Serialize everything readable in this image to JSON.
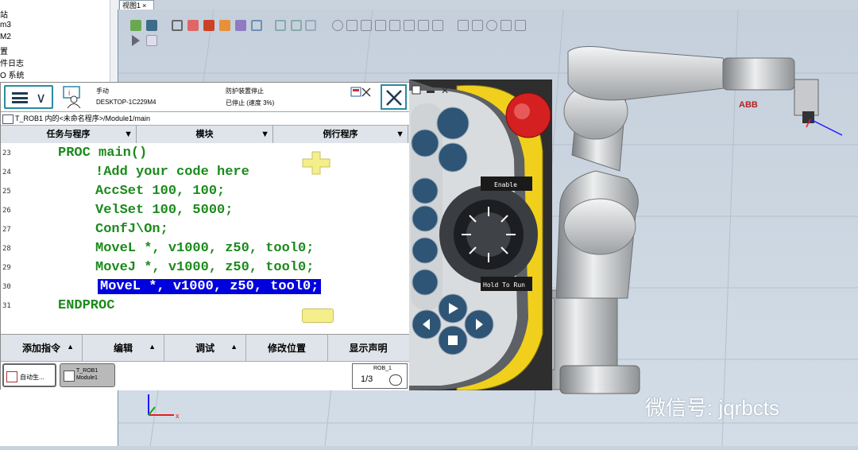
{
  "tree": {
    "items": [
      "站",
      "m3",
      "M2",
      "置",
      "件日志",
      "O 系统"
    ]
  },
  "view_tab": {
    "label": "视图1",
    "close": "×"
  },
  "flexpendant": {
    "status": {
      "mode": "手动",
      "controller": "DESKTOP-1C229M4",
      "state": "防护装置停止",
      "speed": "已停止 (速度 3%)"
    },
    "path": "T_ROB1 内的<未命名程序>/Module1/main",
    "columns": [
      "任务与程序",
      "模块",
      "例行程序"
    ],
    "code_lines": [
      {
        "num": "23",
        "text": "PROC main()",
        "indent": 1
      },
      {
        "num": "24",
        "text": "!Add your code here",
        "indent": 2
      },
      {
        "num": "25",
        "text": "AccSet 100, 100;",
        "indent": 2
      },
      {
        "num": "26",
        "text": "VelSet 100, 5000;",
        "indent": 2
      },
      {
        "num": "27",
        "text": "ConfJ\\On;",
        "indent": 2
      },
      {
        "num": "28",
        "text": "MoveL *, v1000, z50, tool0;",
        "indent": 2
      },
      {
        "num": "29",
        "text": "MoveJ *, v1000, z50, tool0;",
        "indent": 2
      },
      {
        "num": "30",
        "text": "MoveL *, v1000, z50, tool0;",
        "indent": 2,
        "selected": true
      },
      {
        "num": "31",
        "text": "ENDPROC",
        "indent": 1
      }
    ],
    "bottom_buttons": [
      "添加指令",
      "编辑",
      "调试",
      "修改位置",
      "显示声明"
    ],
    "tasks": [
      {
        "label": "自动生..."
      },
      {
        "label": "T_ROB1\nModule1"
      }
    ],
    "quickset": {
      "robot": "ROB_1",
      "speed_fraction": "1/3"
    }
  },
  "hardware": {
    "enable_label": "Enable",
    "hold_label": "Hold To Run"
  },
  "watermark": "微信号: jqrbcts",
  "colors": {
    "code_green": "#1c8a1c",
    "selection_blue": "#0000dd",
    "accent_teal": "#2a8aa0",
    "estop_red": "#d42020",
    "estop_yellow": "#f5d21a"
  }
}
